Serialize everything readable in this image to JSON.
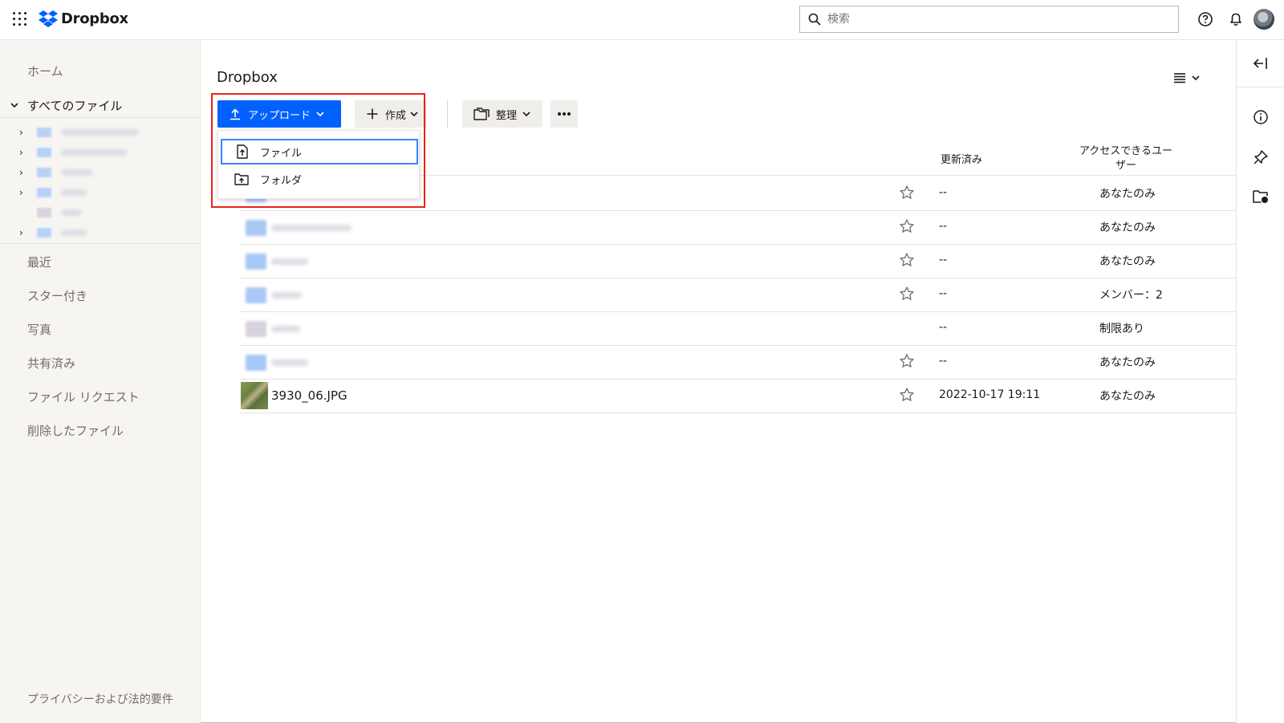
{
  "topbar": {
    "logo_text": "Dropbox",
    "search_placeholder": "検索",
    "icons": [
      "apps-grid-icon",
      "dropbox-logo-icon",
      "search-icon",
      "help-icon",
      "bell-icon",
      "avatar"
    ]
  },
  "sidebar": {
    "home": "ホーム",
    "all_files": "すべてのファイル",
    "recent": "最近",
    "starred": "スター付き",
    "photos": "写真",
    "shared": "共有済み",
    "file_requests": "ファイル リクエスト",
    "deleted_files": "削除したファイル",
    "privacy": "プライバシーおよび法的要件"
  },
  "main": {
    "title": "Dropbox",
    "toolbar": {
      "upload": "アップロード",
      "create": "作成",
      "organize": "整理"
    },
    "upload_menu": {
      "items": [
        {
          "label": "ファイル",
          "icon": "file-upload-icon"
        },
        {
          "label": "フォルダ",
          "icon": "folder-upload-icon"
        }
      ]
    },
    "columns": {
      "updated": "更新済み",
      "access": "アクセスできるユーザー"
    },
    "rows": [
      {
        "name": "",
        "updated": "--",
        "access": "あなたのみ",
        "starrable": true
      },
      {
        "name": "",
        "updated": "--",
        "access": "あなたのみ",
        "starrable": true
      },
      {
        "name": "",
        "updated": "--",
        "access": "あなたのみ",
        "starrable": true
      },
      {
        "name": "",
        "updated": "--",
        "access": "メンバー：2",
        "starrable": true
      },
      {
        "name": "",
        "updated": "--",
        "access": "制限あり",
        "starrable": false
      },
      {
        "name": "",
        "updated": "--",
        "access": "あなたのみ",
        "starrable": true
      },
      {
        "name": "3930_06.JPG",
        "updated": "2022-10-17 19:11",
        "access": "あなたのみ",
        "starrable": true
      }
    ]
  },
  "colors": {
    "accent": "#0061fe",
    "highlight_box": "#e8231d",
    "focus_ring": "#3984ff",
    "sidebar_bg": "#f7f5f2"
  }
}
